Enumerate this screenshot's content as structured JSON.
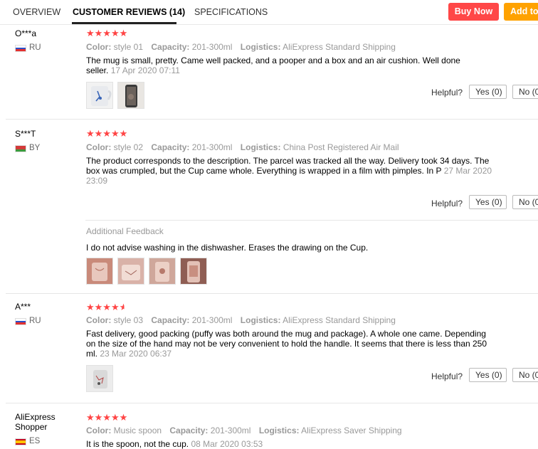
{
  "tabs": [
    {
      "label": "OVERVIEW"
    },
    {
      "label": "CUSTOMER REVIEWS (14)"
    },
    {
      "label": "SPECIFICATIONS"
    }
  ],
  "actions": {
    "buy_now": "Buy Now",
    "add_to_cart": "Add to"
  },
  "labels": {
    "color": "Color:",
    "capacity": "Capacity:",
    "logistics": "Logistics:",
    "helpful": "Helpful?",
    "additional_feedback": "Additional Feedback"
  },
  "colors": {
    "star": "#ff4747",
    "buy_now": "#ff4747",
    "add_to_cart": "#ffa200"
  },
  "reviews": [
    {
      "user": "O***a",
      "country": "RU",
      "rating": 5,
      "stars": "★★★★★",
      "color": "style 01",
      "capacity": "201-300ml",
      "logistics": "AliExpress Standard Shipping",
      "text": "The mug is small, pretty. Came well packed, and a pooper and a box and an air cushion. Well done seller.",
      "date": "17 Apr 2020 07:11",
      "yes": "Yes (0)",
      "no": "No (0"
    },
    {
      "user": "S***T",
      "country": "BY",
      "rating": 5,
      "stars": "★★★★★",
      "color": "style 02",
      "capacity": "201-300ml",
      "logistics": "China Post Registered Air Mail",
      "text": "The product corresponds to the description. The parcel was tracked all the way. Delivery took 34 days. The box was crumpled, but the Cup came whole. Everything is wrapped in a film with pimples. In P",
      "date": "27 Mar 2020 23:09",
      "yes": "Yes (0)",
      "no": "No (0",
      "additional": "I do not advise washing in the dishwasher. Erases the drawing on the Cup."
    },
    {
      "user": "A***",
      "country": "RU",
      "rating": 4.5,
      "stars": "★★★★★",
      "color": "style 03",
      "capacity": "201-300ml",
      "logistics": "AliExpress Standard Shipping",
      "text": "Fast delivery, good packing (puffy was both around the mug and package). A whole one came. Depending on the size of the hand may not be very convenient to hold the handle. It seems that there is less than 250 ml.",
      "date": "23 Mar 2020 06:37",
      "yes": "Yes (0)",
      "no": "No (0"
    },
    {
      "user": "AliExpress Shopper",
      "country": "ES",
      "rating": 5,
      "stars": "★★★★★",
      "color": "Music spoon",
      "capacity": "201-300ml",
      "logistics": "AliExpress Saver Shipping",
      "text": "It is the spoon, not the cup.",
      "date": "08 Mar 2020 03:53"
    }
  ]
}
